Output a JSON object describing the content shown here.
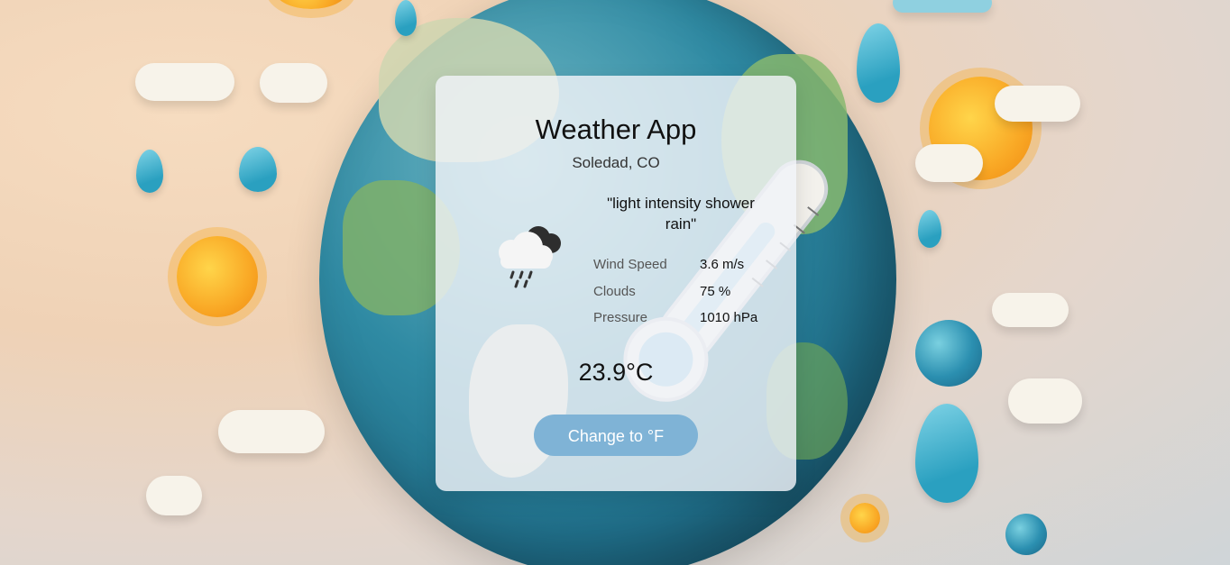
{
  "app": {
    "title": "Weather App",
    "location": "Soledad, CO"
  },
  "weather": {
    "description": "\"light intensity shower rain\"",
    "icon": "cloud-rain-icon",
    "details": [
      {
        "label": "Wind Speed",
        "value": "3.6 m/s"
      },
      {
        "label": "Clouds",
        "value": "75 %"
      },
      {
        "label": "Pressure",
        "value": "1010 hPa"
      }
    ],
    "temperature": "23.9°C"
  },
  "controls": {
    "toggle_unit_label": "Change to °F"
  },
  "colors": {
    "button": "#7fb3d6",
    "card": "#f0f3f8"
  }
}
